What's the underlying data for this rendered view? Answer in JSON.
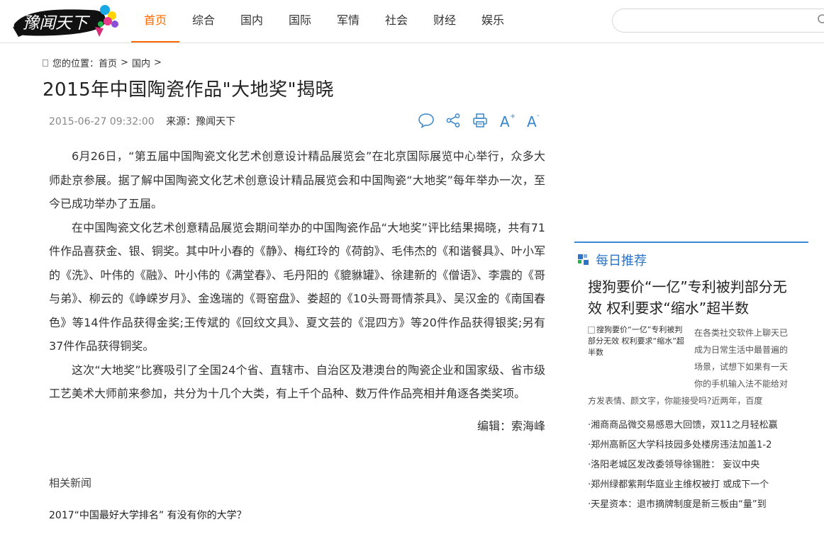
{
  "header": {
    "logo_text": "豫闻天下",
    "nav": [
      "首页",
      "综合",
      "国内",
      "国际",
      "军情",
      "社会",
      "财经",
      "娱乐"
    ],
    "active_nav_index": 0,
    "accent_color": "#ff6a00",
    "search_placeholder": ""
  },
  "breadcrumb": {
    "prefix": "您的位置：",
    "items": [
      "首页",
      "国内"
    ],
    "separator": ">"
  },
  "article": {
    "title": "2015年中国陶瓷作品\"大地奖\"揭晓",
    "datetime": "2015-06-27 09:32:00",
    "source": "来源：豫闻天下",
    "tools": [
      "comment-icon",
      "share-icon",
      "print-icon",
      "font-increase-icon",
      "font-decrease-icon"
    ],
    "paragraphs": [
      "6月26日，“第五届中国陶瓷文化艺术创意设计精品展览会”在北京国际展览中心举行，众多大师赴京参展。据了解中国陶瓷文化艺术创意设计精品展览会和中国陶瓷“大地奖”每年举办一次，至今已成功举办了五届。",
      "在中国陶瓷文化艺术创意精品展览会期间举办的中国陶瓷作品“大地奖”评比结果揭晓，共有71件作品喜获金、银、铜奖。其中叶小春的《静》、梅红玲的《荷韵》、毛伟杰的《和谐餐具》、叶小军的《洗》、叶伟的《融》、叶小伟的《满堂春》、毛丹阳的《貔貅罐》、徐建新的《僧语》、李震的《哥与弟》、柳云的《峥嵘岁月》、金逸瑞的《哥窑盘》、娄超的《10头哥哥情茶具》、吴汉金的《南国春色》等14件作品获得金奖;王传斌的《回纹文具》、夏文芸的《混四方》等20件作品获得银奖;另有37件作品获得铜奖。",
      "这次“大地奖”比赛吸引了全国24个省、直辖市、自治区及港澳台的陶瓷企业和国家级、省市级工艺美术大师前来参加，共分为十几个大类，有上千个品种、数万件作品亮相并角逐各类奖项。"
    ],
    "editor": "编辑：索海峰"
  },
  "related": {
    "heading": "相关新闻",
    "items": [
      "2017“中国最好大学排名” 有没有你的大学？"
    ]
  },
  "sidebar": {
    "accent_color": "#2b74c8",
    "heading": "每日推荐",
    "feature_title": "搜狗要价“一亿”专利被判部分无效 权利要求“缩水”超半数",
    "feature_img_alt": "搜狗要价“一亿”专利被判部分无效 权利要求“缩水”超半数",
    "feature_text": "在各类社交软件上聊天已成为日常生活中最普遍的场景，试想下如果有一天你的手机输入法不能给对方发表情、颜文字，你能接受吗?近两年，百度",
    "list": [
      "·湘商商品微交易感恩大回馈，双11之月轻松赢",
      "·郑州高新区大学科技园多处楼房违法加盖1-2",
      "·洛阳老城区发改委领导徐锡胜： 妄议中央",
      "·郑州绿都紫荆华庭业主维权被打 或成下一个",
      "·天星资本：退市摘牌制度是新三板由“量”到"
    ]
  }
}
